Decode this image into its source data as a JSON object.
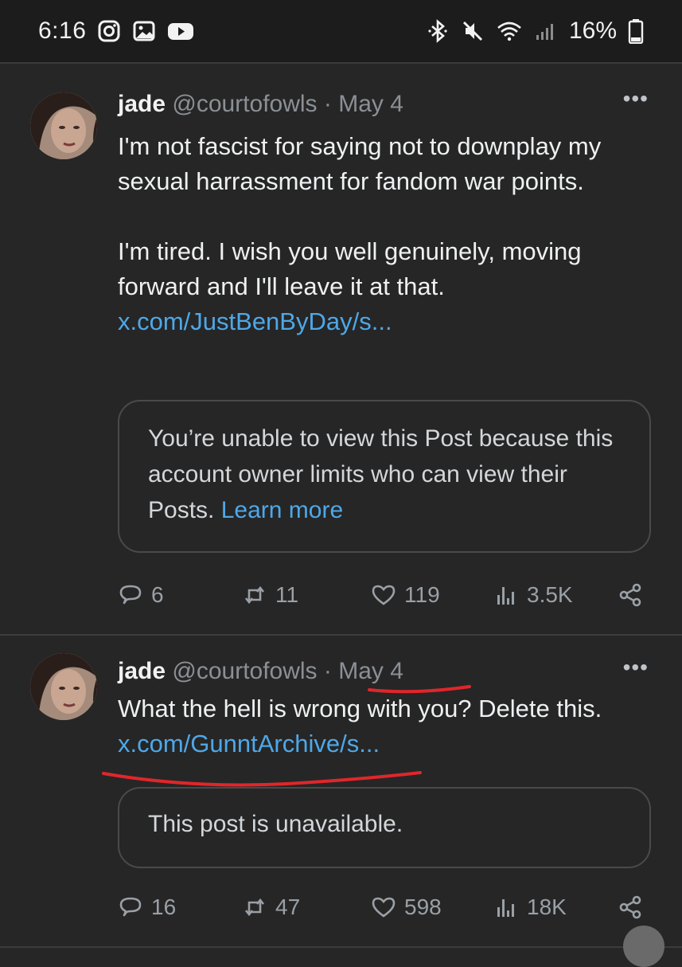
{
  "status_bar": {
    "time": "6:16",
    "battery": "16%",
    "left_icons": [
      "instagram-icon",
      "gallery-icon",
      "youtube-icon"
    ],
    "right_icons": [
      "bluetooth-icon",
      "mute-icon",
      "wifi-icon",
      "signal-icon",
      "battery-icon"
    ]
  },
  "posts": [
    {
      "name": "jade",
      "handle": "@courtofowls",
      "separator": "·",
      "date": "May 4",
      "more": "•••",
      "text_lines": [
        "I'm not fascist for saying not to downplay my sexual harrassment for fandom war points.",
        "I'm tired. I wish you well genuinely, moving forward and I'll leave it at that."
      ],
      "link": "x.com/JustBenByDay/s...",
      "card_text": "You’re unable to view this Post because this account owner limits who can view their Posts.",
      "card_link": "Learn more",
      "replies": "6",
      "reposts": "11",
      "likes": "119",
      "views": "3.5K"
    },
    {
      "name": "jade",
      "handle": "@courtofowls",
      "separator": "·",
      "date": "May 4",
      "more": "•••",
      "text_lines": [
        "What the hell is wrong with you? Delete this."
      ],
      "link": "x.com/GunntArchive/s...",
      "card_text": "This post is unavailable.",
      "replies": "16",
      "reposts": "47",
      "likes": "598",
      "views": "18K"
    }
  ],
  "colors": {
    "background": "#262626",
    "link": "#4ea8e8",
    "annotation": "#e0262b"
  }
}
